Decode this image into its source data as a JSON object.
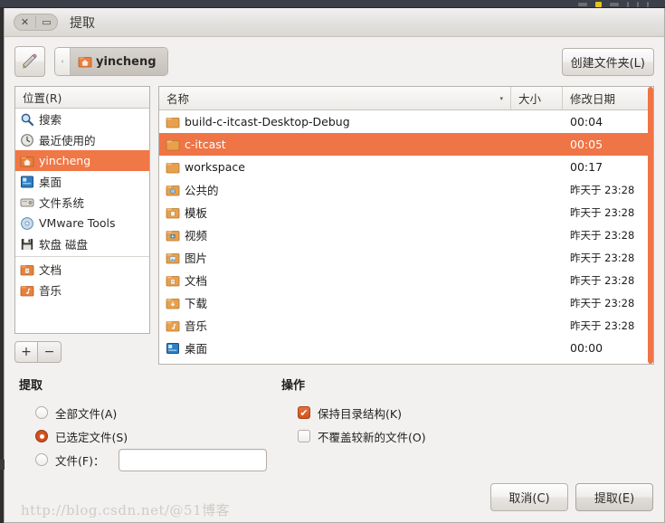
{
  "window": {
    "title": "提取",
    "close_label": "✕",
    "minimize_label": "▭"
  },
  "pathbar": {
    "edit_icon": "pencil-icon",
    "prev_crumb_label": "‹",
    "current_folder": "yincheng",
    "create_folder_label": "创建文件夹(L)"
  },
  "places": {
    "header": "位置(R)",
    "items": [
      {
        "label": "搜索",
        "icon": "search-icon",
        "selected": false,
        "sep_after": false
      },
      {
        "label": "最近使用的",
        "icon": "recent-icon",
        "selected": false,
        "sep_after": false
      },
      {
        "label": "yincheng",
        "icon": "home-folder-icon",
        "selected": true,
        "sep_after": false
      },
      {
        "label": "桌面",
        "icon": "desktop-icon",
        "selected": false,
        "sep_after": false
      },
      {
        "label": "文件系统",
        "icon": "drive-icon",
        "selected": false,
        "sep_after": false
      },
      {
        "label": "VMware Tools",
        "icon": "disc-icon",
        "selected": false,
        "sep_after": false
      },
      {
        "label": "软盘 磁盘",
        "icon": "floppy-icon",
        "selected": false,
        "sep_after": true
      },
      {
        "label": "文档",
        "icon": "documents-folder-icon",
        "selected": false,
        "sep_after": false
      },
      {
        "label": "音乐",
        "icon": "music-folder-icon",
        "selected": false,
        "sep_after": false
      }
    ],
    "add_label": "+",
    "remove_label": "−"
  },
  "filelist": {
    "columns": {
      "name": "名称",
      "size": "大小",
      "date": "修改日期"
    },
    "sort_arrow": "▾",
    "rows": [
      {
        "name": "build-c-itcast-Desktop-Debug",
        "icon": "folder-icon",
        "size": "",
        "date": "00:04",
        "selected": false
      },
      {
        "name": "c-itcast",
        "icon": "folder-icon",
        "size": "",
        "date": "00:05",
        "selected": true
      },
      {
        "name": "workspace",
        "icon": "folder-icon",
        "size": "",
        "date": "00:17",
        "selected": false
      },
      {
        "name": "公共的",
        "icon": "public-folder-icon",
        "size": "",
        "date": "昨天于 23:28",
        "selected": false
      },
      {
        "name": "模板",
        "icon": "templates-folder-icon",
        "size": "",
        "date": "昨天于 23:28",
        "selected": false
      },
      {
        "name": "视频",
        "icon": "videos-folder-icon",
        "size": "",
        "date": "昨天于 23:28",
        "selected": false
      },
      {
        "name": "图片",
        "icon": "pictures-folder-icon",
        "size": "",
        "date": "昨天于 23:28",
        "selected": false
      },
      {
        "name": "文档",
        "icon": "documents-folder-icon",
        "size": "",
        "date": "昨天于 23:28",
        "selected": false
      },
      {
        "name": "下载",
        "icon": "downloads-folder-icon",
        "size": "",
        "date": "昨天于 23:28",
        "selected": false
      },
      {
        "name": "音乐",
        "icon": "music-folder-icon",
        "size": "",
        "date": "昨天于 23:28",
        "selected": false
      },
      {
        "name": "桌面",
        "icon": "desktop-folder-icon",
        "size": "",
        "date": "00:00",
        "selected": false
      }
    ]
  },
  "options": {
    "extract": {
      "title": "提取",
      "all_files": "全部文件(A)",
      "selected_files": "已选定文件(S)",
      "files_pattern": "文件(F)：",
      "selected_value": "selected_files",
      "pattern_value": "",
      "pattern_placeholder": ""
    },
    "actions": {
      "title": "操作",
      "keep_structure": "保持目录结构(K)",
      "keep_structure_checked": true,
      "check_mark": "✔",
      "no_overwrite": "不覆盖较新的文件(O)",
      "no_overwrite_checked": false
    }
  },
  "buttons": {
    "cancel": "取消(C)",
    "extract": "提取(E)"
  },
  "watermark": {
    "text": "http://blog.csdn.net/@51博客"
  },
  "colors": {
    "selection": "#ef7446",
    "window_bg": "#f2f1f0",
    "panel": "#3c4049"
  }
}
